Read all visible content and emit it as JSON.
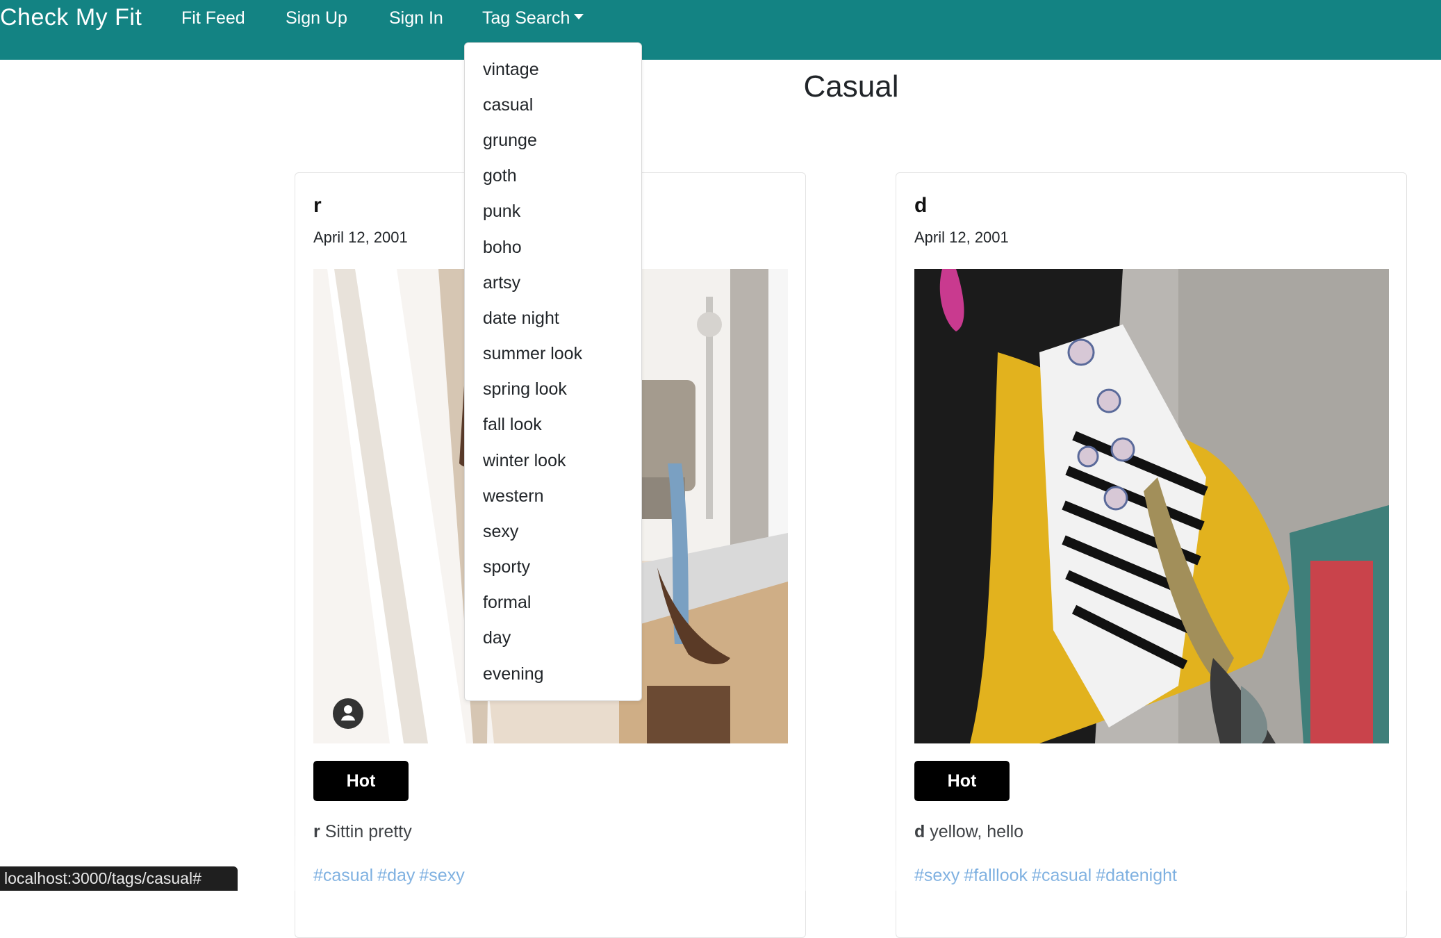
{
  "navbar": {
    "brand": "Check My Fit",
    "links": [
      "Fit Feed",
      "Sign Up",
      "Sign In"
    ],
    "tag_search_label": "Tag Search",
    "background": "#138383"
  },
  "page_title": "Casual",
  "tag_menu": {
    "items": [
      "vintage",
      "casual",
      "grunge",
      "goth",
      "punk",
      "boho",
      "artsy",
      "date night",
      "summer look",
      "spring look",
      "fall look",
      "winter look",
      "western",
      "sexy",
      "sporty",
      "formal",
      "day",
      "evening"
    ]
  },
  "posts": [
    {
      "user": "r",
      "date": "April 12, 2001",
      "button": "Hot",
      "caption_user": "r",
      "caption_text": "Sittin pretty",
      "tags": [
        "#casual",
        "#day",
        "#sexy"
      ]
    },
    {
      "user": "d",
      "date": "April 12, 2001",
      "button": "Hot",
      "caption_user": "d",
      "caption_text": "yellow, hello",
      "tags": [
        "#sexy",
        "#falllook",
        "#casual",
        "#datenight"
      ]
    }
  ],
  "status_bar": {
    "url": "localhost:3000/tags/casual#"
  },
  "colors": {
    "accent": "#138383",
    "link": "#1a73c9",
    "button": "#000000"
  }
}
